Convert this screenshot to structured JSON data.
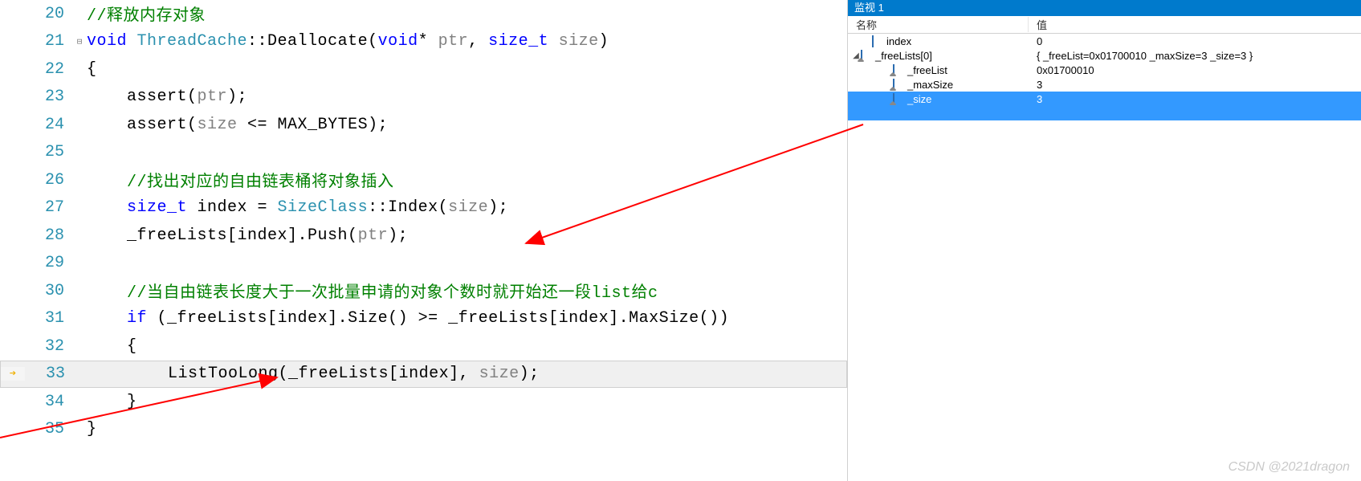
{
  "editor": {
    "lines": [
      {
        "num": 20,
        "tokens": [
          {
            "t": "//释放内存对象",
            "c": "comment"
          }
        ],
        "indent": 0
      },
      {
        "num": 21,
        "fold": "⊟",
        "tokens": [
          {
            "t": "void ",
            "c": "kw"
          },
          {
            "t": "ThreadCache",
            "c": "cls"
          },
          {
            "t": "::Deallocate(",
            "c": "op"
          },
          {
            "t": "void",
            "c": "kw"
          },
          {
            "t": "* ",
            "c": "op"
          },
          {
            "t": "ptr",
            "c": "param"
          },
          {
            "t": ", ",
            "c": "op"
          },
          {
            "t": "size_t ",
            "c": "kw"
          },
          {
            "t": "size",
            "c": "param"
          },
          {
            "t": ")",
            "c": "op"
          }
        ],
        "indent": 0
      },
      {
        "num": 22,
        "tokens": [
          {
            "t": "{",
            "c": "op"
          }
        ],
        "indent": 0
      },
      {
        "num": 23,
        "tokens": [
          {
            "t": "assert(",
            "c": "func"
          },
          {
            "t": "ptr",
            "c": "param"
          },
          {
            "t": ");",
            "c": "op"
          }
        ],
        "indent": 1
      },
      {
        "num": 24,
        "tokens": [
          {
            "t": "assert(",
            "c": "func"
          },
          {
            "t": "size",
            "c": "param"
          },
          {
            "t": " <= MAX_BYTES);",
            "c": "op"
          }
        ],
        "indent": 1
      },
      {
        "num": 25,
        "tokens": [],
        "indent": 0
      },
      {
        "num": 26,
        "tokens": [
          {
            "t": "//找出对应的自由链表桶将对象插入",
            "c": "comment"
          }
        ],
        "indent": 1
      },
      {
        "num": 27,
        "tokens": [
          {
            "t": "size_t ",
            "c": "kw"
          },
          {
            "t": "index = ",
            "c": "op"
          },
          {
            "t": "SizeClass",
            "c": "cls"
          },
          {
            "t": "::Index(",
            "c": "op"
          },
          {
            "t": "size",
            "c": "param"
          },
          {
            "t": ");",
            "c": "op"
          }
        ],
        "indent": 1
      },
      {
        "num": 28,
        "tokens": [
          {
            "t": "_freeLists[index].Push(",
            "c": "op"
          },
          {
            "t": "ptr",
            "c": "param"
          },
          {
            "t": ");",
            "c": "op"
          }
        ],
        "indent": 1
      },
      {
        "num": 29,
        "tokens": [],
        "indent": 0
      },
      {
        "num": 30,
        "tokens": [
          {
            "t": "//当自由链表长度大于一次批量申请的对象个数时就开始还一段list给c",
            "c": "comment"
          }
        ],
        "indent": 1
      },
      {
        "num": 31,
        "tokens": [
          {
            "t": "if ",
            "c": "kw"
          },
          {
            "t": "(_freeLists[index].Size() >= _freeLists[index].MaxSize())",
            "c": "op"
          }
        ],
        "indent": 1
      },
      {
        "num": 32,
        "tokens": [
          {
            "t": "{",
            "c": "op"
          }
        ],
        "indent": 1
      },
      {
        "num": 33,
        "current": true,
        "tokens": [
          {
            "t": "ListTooLong(_freeLists[index], ",
            "c": "op"
          },
          {
            "t": "size",
            "c": "param"
          },
          {
            "t": ");",
            "c": "op"
          }
        ],
        "indent": 2
      },
      {
        "num": 34,
        "tokens": [
          {
            "t": "}",
            "c": "op"
          }
        ],
        "indent": 1
      },
      {
        "num": 35,
        "tokens": [
          {
            "t": "}",
            "c": "op"
          }
        ],
        "indent": 0
      }
    ]
  },
  "watch": {
    "title": "监视 1",
    "headers": {
      "name": "名称",
      "value": "值"
    },
    "rows": [
      {
        "indent": 1,
        "expander": "",
        "icon": "cube",
        "name": "index",
        "value": "0"
      },
      {
        "indent": 0,
        "expander": "◢",
        "icon": "cube-lock",
        "name": "_freeLists[0]",
        "value": "{ _freeList=0x01700010 _maxSize=3 _size=3 }"
      },
      {
        "indent": 2,
        "expander": "",
        "icon": "cube-lock",
        "name": "_freeList",
        "value": "0x01700010"
      },
      {
        "indent": 2,
        "expander": "",
        "icon": "cube-lock",
        "name": "_maxSize",
        "value": "3"
      },
      {
        "indent": 2,
        "expander": "",
        "icon": "cube-lock",
        "name": "_size",
        "value": "3",
        "selected": true
      }
    ]
  },
  "watermark": "CSDN @2021dragon"
}
